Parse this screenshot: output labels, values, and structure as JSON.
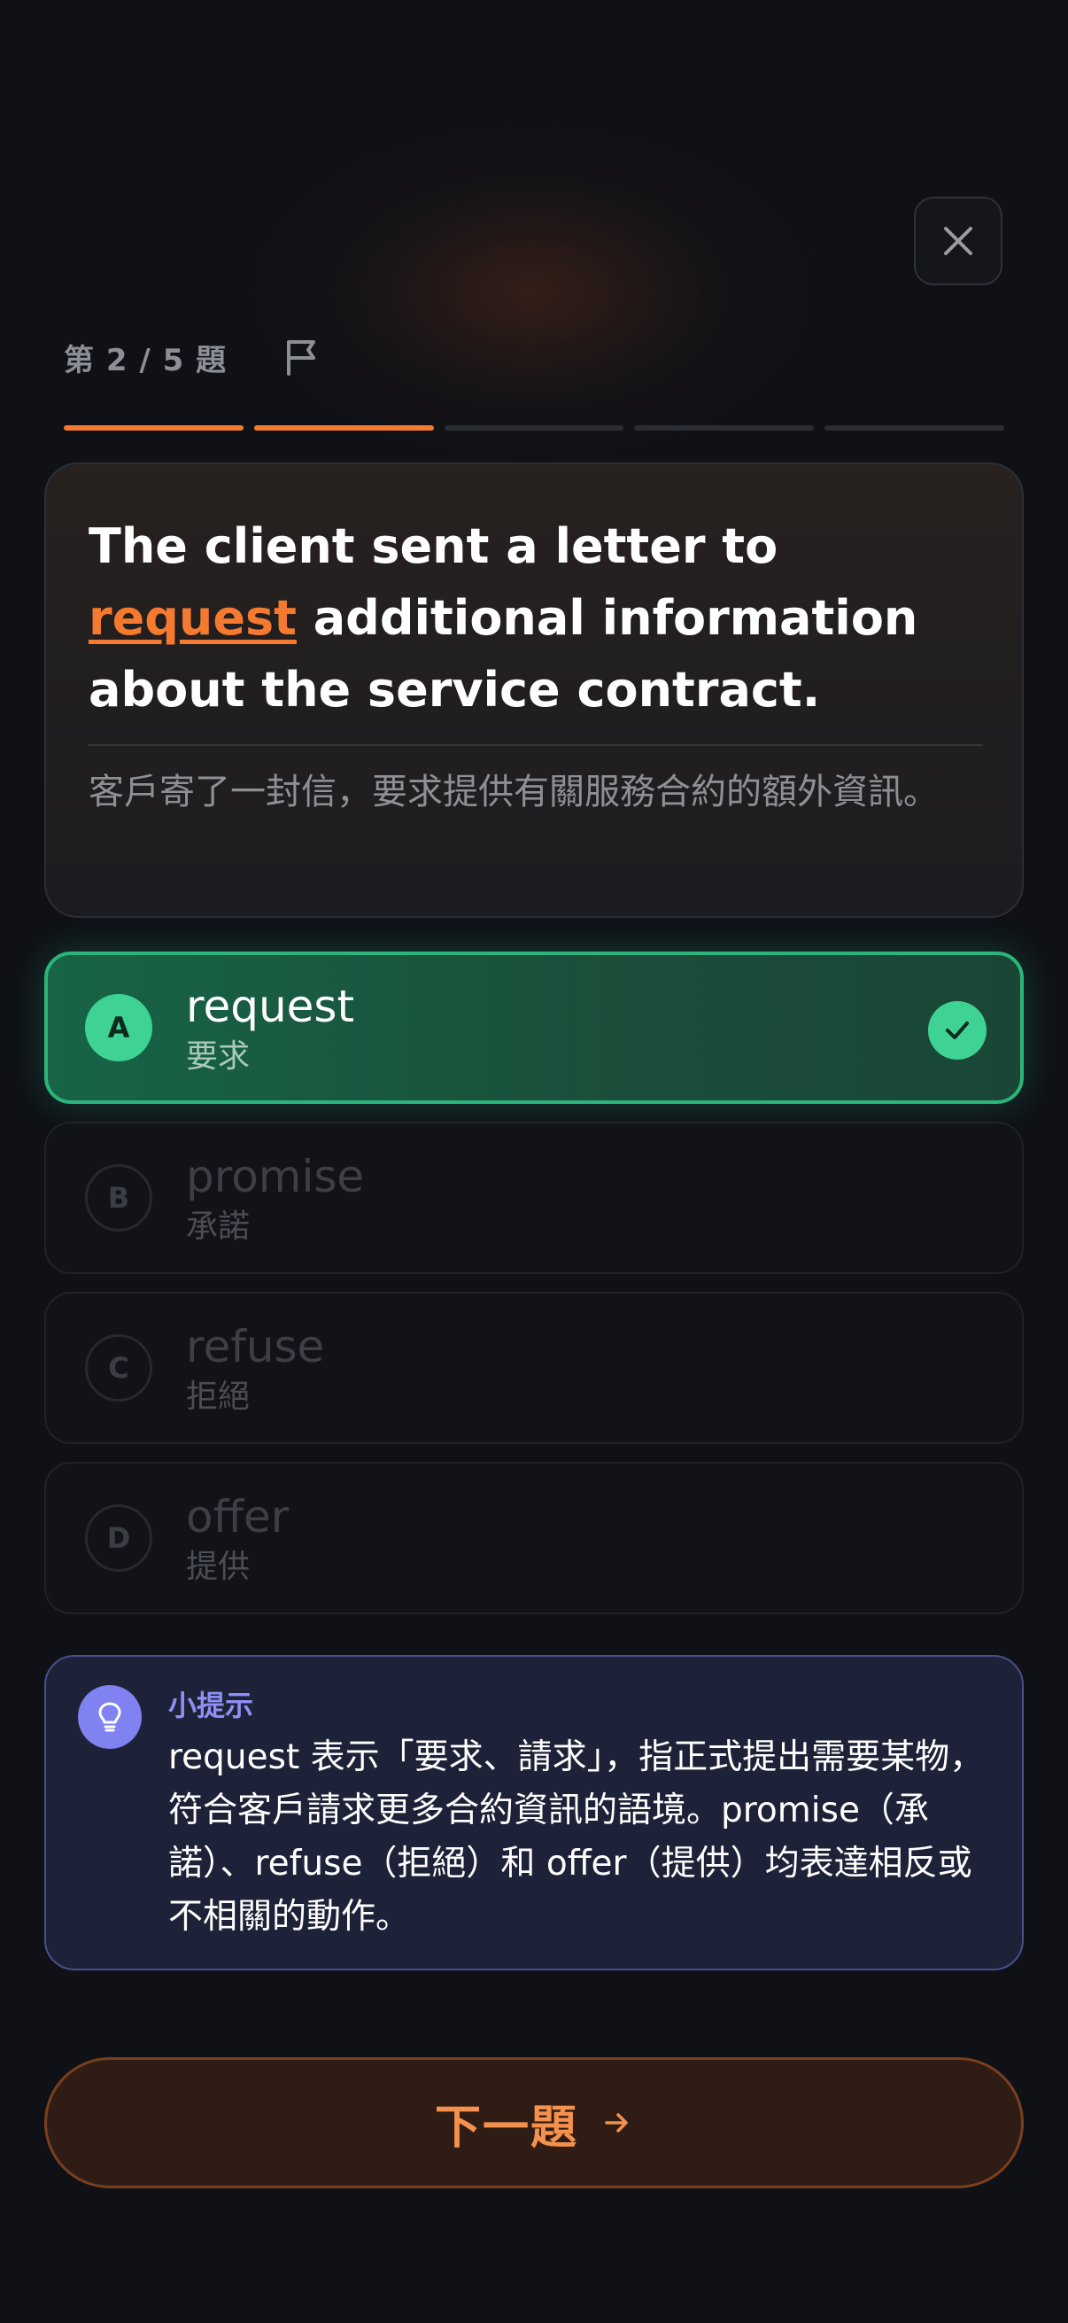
{
  "header": {
    "counter": "第 2 / 5 題",
    "close_icon": "close-icon",
    "flag_icon": "flag-icon"
  },
  "progress": {
    "current": 2,
    "total": 5,
    "active_color": "#f47a2f",
    "inactive_color": "#2a2d33"
  },
  "question": {
    "text_before": "The client sent a letter to ",
    "answer": " request",
    "text_after": " additional information about the service contract.",
    "translation": "客戶寄了一封信，要求提供有關服務合約的額外資訊。"
  },
  "options": [
    {
      "letter": "A",
      "word": "request",
      "meaning": "要求",
      "state": "correct"
    },
    {
      "letter": "B",
      "word": "promise",
      "meaning": "承諾",
      "state": "disabled"
    },
    {
      "letter": "C",
      "word": "refuse",
      "meaning": "拒絕",
      "state": "disabled"
    },
    {
      "letter": "D",
      "word": "offer",
      "meaning": "提供",
      "state": "disabled"
    }
  ],
  "hint": {
    "icon": "lightbulb-icon",
    "title": "小提示",
    "body": "request 表示「要求、請求」，指正式提出需要某物，符合客戶請求更多合約資訊的語境。promise（承諾）、refuse（拒絕）和 offer（提供）均表達相反或不相關的動作。"
  },
  "next_button": {
    "label": "下一題",
    "icon": "arrow-right-icon"
  },
  "colors": {
    "background": "#0f1117",
    "accent": "#f47a2f",
    "correct": "#3ed394",
    "hint_accent": "#7f82f0"
  }
}
